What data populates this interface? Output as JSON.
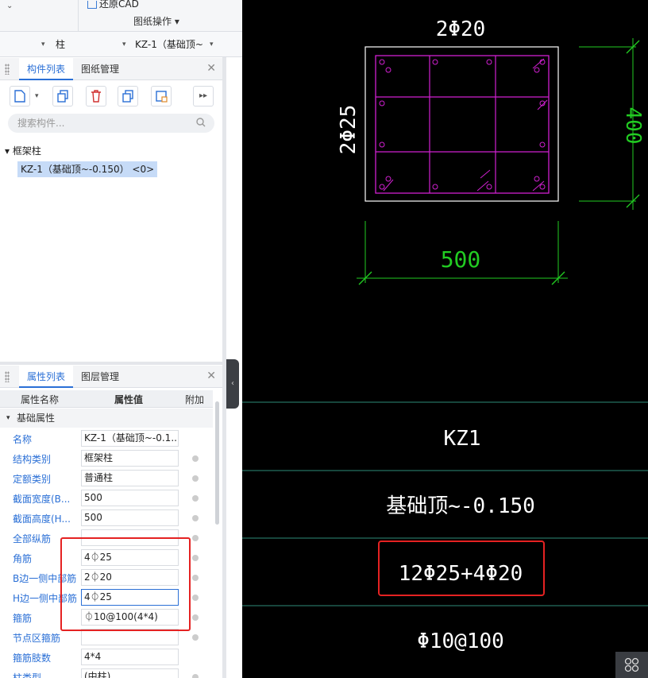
{
  "ribbon": {
    "restore_label": "还原CAD",
    "op_label": "图纸操作 ▾"
  },
  "selector": {
    "type_value": "柱",
    "element_value": "KZ-1（基础顶~"
  },
  "component_panel": {
    "tabs": [
      "构件列表",
      "图纸管理"
    ],
    "search_placeholder": "搜索构件...",
    "tree_group": "▾ 框架柱",
    "tree_item": "KZ-1（基础顶~-0.150）  <0>"
  },
  "property_panel": {
    "tabs": [
      "属性列表",
      "图层管理"
    ],
    "columns": [
      "属性名称",
      "属性值",
      "附加"
    ],
    "group": "基础属性",
    "rows": [
      {
        "name": "名称",
        "value": "KZ-1（基础顶~-0.1..."
      },
      {
        "name": "结构类别",
        "value": "框架柱"
      },
      {
        "name": "定额类别",
        "value": "普通柱"
      },
      {
        "name": "截面宽度(B...",
        "value": "500"
      },
      {
        "name": "截面高度(H...",
        "value": "500"
      },
      {
        "name": "全部纵筋",
        "value": ""
      },
      {
        "name": "角筋",
        "value": "4⏀25"
      },
      {
        "name": "B边一侧中部筋",
        "value": "2⏀20"
      },
      {
        "name": "H边一侧中部筋",
        "value": "4⏀25"
      },
      {
        "name": "箍筋",
        "value": "⏀10@100(4*4)"
      },
      {
        "name": "节点区箍筋",
        "value": ""
      },
      {
        "name": "箍筋肢数",
        "value": "4*4"
      },
      {
        "name": "柱类型",
        "value": "(中柱)"
      }
    ]
  },
  "cad": {
    "top_rebar": "2Φ20",
    "side_rebar": "2Φ25",
    "dim_height": "400",
    "dim_width": "500",
    "col_name": "KZ1",
    "col_range": "基础顶~-0.150",
    "col_main_rebar": "12Φ25+4Φ20",
    "col_stirrup": "Φ10@100"
  },
  "colors": {
    "accent": "#2a6fd6",
    "highlight": "#e52222",
    "cad_rebar": "#d020d0",
    "cad_dim": "#22cc22",
    "cad_line": "#2e8b78"
  }
}
